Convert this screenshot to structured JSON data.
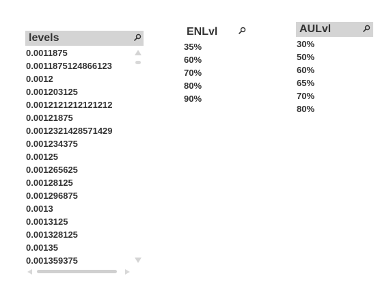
{
  "colors": {
    "header_active": "#d4d4d4",
    "header_plain": "#ffffff",
    "text": "#333333",
    "scrollbar": "#d4d4d4"
  },
  "listboxes": [
    {
      "title": "levels",
      "search_icon": "search-icon",
      "values": [
        "0.0011875",
        "0.0011875124866123",
        "0.0012",
        "0.001203125",
        "0.0012121212121212",
        "0.00121875",
        "0.0012321428571429",
        "0.001234375",
        "0.00125",
        "0.001265625",
        "0.00128125",
        "0.001296875",
        "0.0013",
        "0.0013125",
        "0.001328125",
        "0.00135",
        "0.001359375"
      ]
    },
    {
      "title": "ENLvl",
      "search_icon": "search-icon",
      "values": [
        "35%",
        "60%",
        "70%",
        "80%",
        "90%"
      ]
    },
    {
      "title": "AULvl",
      "search_icon": "search-icon",
      "values": [
        "30%",
        "50%",
        "60%",
        "65%",
        "70%",
        "80%"
      ]
    }
  ]
}
